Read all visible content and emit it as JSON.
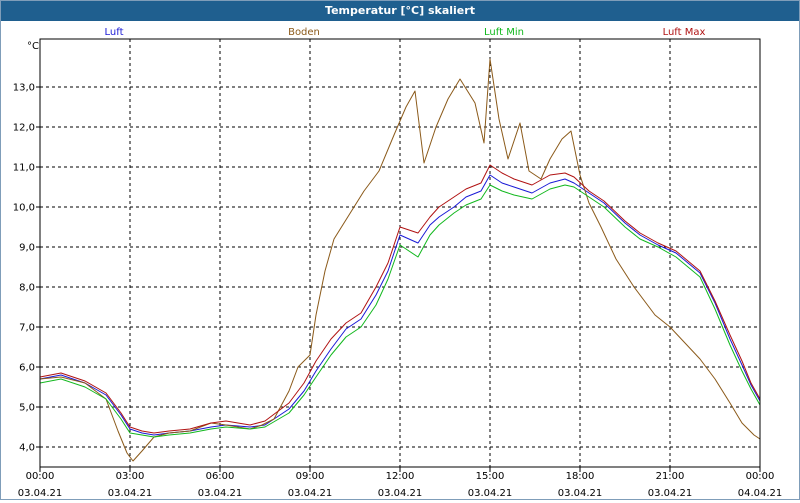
{
  "window": {
    "title": "Temperatur [°C] skaliert"
  },
  "chart_data": {
    "type": "line",
    "title": "Temperatur [°C] skaliert",
    "ylabel": "°C",
    "xlabel": "",
    "xlim": [
      0,
      24
    ],
    "ylim": [
      3.5,
      14.2
    ],
    "grid": true,
    "legend_position": "top",
    "y_ticks": [
      "4,0",
      "5,0",
      "6,0",
      "7,0",
      "8,0",
      "9,0",
      "10,0",
      "11,0",
      "12,0",
      "13,0"
    ],
    "x_ticks": [
      {
        "time": "00:00",
        "date": "03.04.21"
      },
      {
        "time": "03:00",
        "date": "03.04.21"
      },
      {
        "time": "06:00",
        "date": "03.04.21"
      },
      {
        "time": "09:00",
        "date": "03.04.21"
      },
      {
        "time": "12:00",
        "date": "03.04.21"
      },
      {
        "time": "15:00",
        "date": "03.04.21"
      },
      {
        "time": "18:00",
        "date": "03.04.21"
      },
      {
        "time": "21:00",
        "date": "03.04.21"
      },
      {
        "time": "00:00",
        "date": "04.04.21"
      }
    ],
    "series": [
      {
        "name": "Luft",
        "color": "#1a1ad6",
        "points": [
          [
            0,
            5.7
          ],
          [
            0.7,
            5.8
          ],
          [
            1.5,
            5.6
          ],
          [
            2.2,
            5.3
          ],
          [
            2.7,
            4.8
          ],
          [
            3.0,
            4.45
          ],
          [
            3.4,
            4.35
          ],
          [
            3.8,
            4.3
          ],
          [
            4.3,
            4.35
          ],
          [
            5.0,
            4.4
          ],
          [
            5.7,
            4.5
          ],
          [
            6.2,
            4.55
          ],
          [
            7.0,
            4.5
          ],
          [
            7.5,
            4.55
          ],
          [
            8.3,
            4.95
          ],
          [
            8.8,
            5.4
          ],
          [
            9.2,
            5.9
          ],
          [
            9.7,
            6.45
          ],
          [
            10.2,
            6.95
          ],
          [
            10.7,
            7.2
          ],
          [
            11.2,
            7.8
          ],
          [
            11.6,
            8.4
          ],
          [
            12.0,
            9.3
          ],
          [
            12.6,
            9.1
          ],
          [
            13.0,
            9.55
          ],
          [
            13.3,
            9.75
          ],
          [
            13.8,
            10.0
          ],
          [
            14.2,
            10.25
          ],
          [
            14.7,
            10.4
          ],
          [
            15.0,
            10.8
          ],
          [
            15.4,
            10.6
          ],
          [
            15.8,
            10.5
          ],
          [
            16.4,
            10.35
          ],
          [
            17.0,
            10.6
          ],
          [
            17.5,
            10.7
          ],
          [
            17.8,
            10.6
          ],
          [
            18.3,
            10.35
          ],
          [
            18.8,
            10.1
          ],
          [
            19.5,
            9.6
          ],
          [
            20.0,
            9.3
          ],
          [
            20.6,
            9.05
          ],
          [
            21.2,
            8.85
          ],
          [
            21.6,
            8.6
          ],
          [
            22.0,
            8.35
          ],
          [
            22.5,
            7.6
          ],
          [
            23.0,
            6.7
          ],
          [
            23.4,
            6.05
          ],
          [
            23.7,
            5.55
          ],
          [
            24.0,
            5.15
          ]
        ]
      },
      {
        "name": "Boden",
        "color": "#8b5a1a",
        "points": [
          [
            0,
            5.7
          ],
          [
            0.7,
            5.75
          ],
          [
            1.5,
            5.6
          ],
          [
            2.2,
            5.2
          ],
          [
            2.6,
            4.4
          ],
          [
            2.9,
            3.85
          ],
          [
            3.1,
            3.65
          ],
          [
            3.4,
            3.9
          ],
          [
            3.8,
            4.25
          ],
          [
            4.3,
            4.35
          ],
          [
            5.0,
            4.4
          ],
          [
            5.7,
            4.6
          ],
          [
            6.2,
            4.55
          ],
          [
            7.0,
            4.45
          ],
          [
            7.4,
            4.55
          ],
          [
            7.8,
            4.7
          ],
          [
            8.3,
            5.4
          ],
          [
            8.6,
            6.0
          ],
          [
            9.0,
            6.3
          ],
          [
            9.2,
            7.3
          ],
          [
            9.5,
            8.4
          ],
          [
            9.8,
            9.2
          ],
          [
            10.3,
            9.8
          ],
          [
            10.8,
            10.4
          ],
          [
            11.3,
            10.9
          ],
          [
            11.8,
            11.8
          ],
          [
            12.2,
            12.5
          ],
          [
            12.5,
            12.9
          ],
          [
            12.8,
            11.1
          ],
          [
            13.2,
            12.0
          ],
          [
            13.6,
            12.7
          ],
          [
            14.0,
            13.2
          ],
          [
            14.5,
            12.6
          ],
          [
            14.8,
            11.6
          ],
          [
            15.0,
            13.7
          ],
          [
            15.3,
            12.2
          ],
          [
            15.6,
            11.2
          ],
          [
            16.0,
            12.1
          ],
          [
            16.3,
            10.9
          ],
          [
            16.7,
            10.7
          ],
          [
            17.0,
            11.2
          ],
          [
            17.4,
            11.7
          ],
          [
            17.7,
            11.9
          ],
          [
            18.0,
            10.8
          ],
          [
            18.3,
            10.1
          ],
          [
            18.7,
            9.5
          ],
          [
            19.2,
            8.7
          ],
          [
            19.8,
            8.0
          ],
          [
            20.5,
            7.3
          ],
          [
            21.0,
            7.0
          ],
          [
            21.5,
            6.6
          ],
          [
            22.0,
            6.2
          ],
          [
            22.5,
            5.7
          ],
          [
            23.0,
            5.1
          ],
          [
            23.4,
            4.6
          ],
          [
            23.8,
            4.3
          ],
          [
            24.0,
            4.2
          ]
        ]
      },
      {
        "name": "Luft Min",
        "color": "#12b81e",
        "points": [
          [
            0,
            5.6
          ],
          [
            0.7,
            5.7
          ],
          [
            1.5,
            5.5
          ],
          [
            2.2,
            5.2
          ],
          [
            2.7,
            4.7
          ],
          [
            3.0,
            4.35
          ],
          [
            3.4,
            4.3
          ],
          [
            3.8,
            4.25
          ],
          [
            4.3,
            4.3
          ],
          [
            5.0,
            4.35
          ],
          [
            5.7,
            4.45
          ],
          [
            6.2,
            4.5
          ],
          [
            7.0,
            4.45
          ],
          [
            7.5,
            4.5
          ],
          [
            8.3,
            4.85
          ],
          [
            8.8,
            5.3
          ],
          [
            9.2,
            5.75
          ],
          [
            9.7,
            6.3
          ],
          [
            10.2,
            6.75
          ],
          [
            10.7,
            7.0
          ],
          [
            11.2,
            7.55
          ],
          [
            11.6,
            8.2
          ],
          [
            12.0,
            9.05
          ],
          [
            12.6,
            8.75
          ],
          [
            13.0,
            9.3
          ],
          [
            13.3,
            9.55
          ],
          [
            13.8,
            9.85
          ],
          [
            14.2,
            10.05
          ],
          [
            14.7,
            10.2
          ],
          [
            15.0,
            10.55
          ],
          [
            15.4,
            10.4
          ],
          [
            15.8,
            10.3
          ],
          [
            16.4,
            10.2
          ],
          [
            17.0,
            10.45
          ],
          [
            17.5,
            10.55
          ],
          [
            17.8,
            10.5
          ],
          [
            18.3,
            10.25
          ],
          [
            18.8,
            10.0
          ],
          [
            19.5,
            9.5
          ],
          [
            20.0,
            9.2
          ],
          [
            20.6,
            9.0
          ],
          [
            21.2,
            8.75
          ],
          [
            21.6,
            8.5
          ],
          [
            22.0,
            8.25
          ],
          [
            22.5,
            7.45
          ],
          [
            23.0,
            6.55
          ],
          [
            23.4,
            5.9
          ],
          [
            23.7,
            5.45
          ],
          [
            24.0,
            5.05
          ]
        ]
      },
      {
        "name": "Luft Max",
        "color": "#b01212",
        "points": [
          [
            0,
            5.75
          ],
          [
            0.7,
            5.85
          ],
          [
            1.5,
            5.65
          ],
          [
            2.2,
            5.35
          ],
          [
            2.7,
            4.85
          ],
          [
            3.0,
            4.5
          ],
          [
            3.4,
            4.4
          ],
          [
            3.8,
            4.35
          ],
          [
            4.3,
            4.4
          ],
          [
            5.0,
            4.45
          ],
          [
            5.7,
            4.6
          ],
          [
            6.2,
            4.65
          ],
          [
            7.0,
            4.55
          ],
          [
            7.5,
            4.65
          ],
          [
            8.3,
            5.1
          ],
          [
            8.8,
            5.6
          ],
          [
            9.2,
            6.15
          ],
          [
            9.7,
            6.7
          ],
          [
            10.2,
            7.1
          ],
          [
            10.7,
            7.35
          ],
          [
            11.2,
            8.0
          ],
          [
            11.6,
            8.6
          ],
          [
            12.0,
            9.5
          ],
          [
            12.6,
            9.35
          ],
          [
            13.0,
            9.75
          ],
          [
            13.3,
            10.0
          ],
          [
            13.8,
            10.25
          ],
          [
            14.2,
            10.45
          ],
          [
            14.7,
            10.6
          ],
          [
            15.0,
            11.05
          ],
          [
            15.4,
            10.85
          ],
          [
            15.8,
            10.7
          ],
          [
            16.4,
            10.55
          ],
          [
            17.0,
            10.8
          ],
          [
            17.5,
            10.85
          ],
          [
            17.8,
            10.75
          ],
          [
            18.3,
            10.4
          ],
          [
            18.8,
            10.15
          ],
          [
            19.5,
            9.65
          ],
          [
            20.0,
            9.35
          ],
          [
            20.6,
            9.1
          ],
          [
            21.2,
            8.9
          ],
          [
            21.6,
            8.65
          ],
          [
            22.0,
            8.4
          ],
          [
            22.5,
            7.65
          ],
          [
            23.0,
            6.8
          ],
          [
            23.4,
            6.15
          ],
          [
            23.7,
            5.6
          ],
          [
            24.0,
            5.2
          ]
        ]
      }
    ]
  }
}
